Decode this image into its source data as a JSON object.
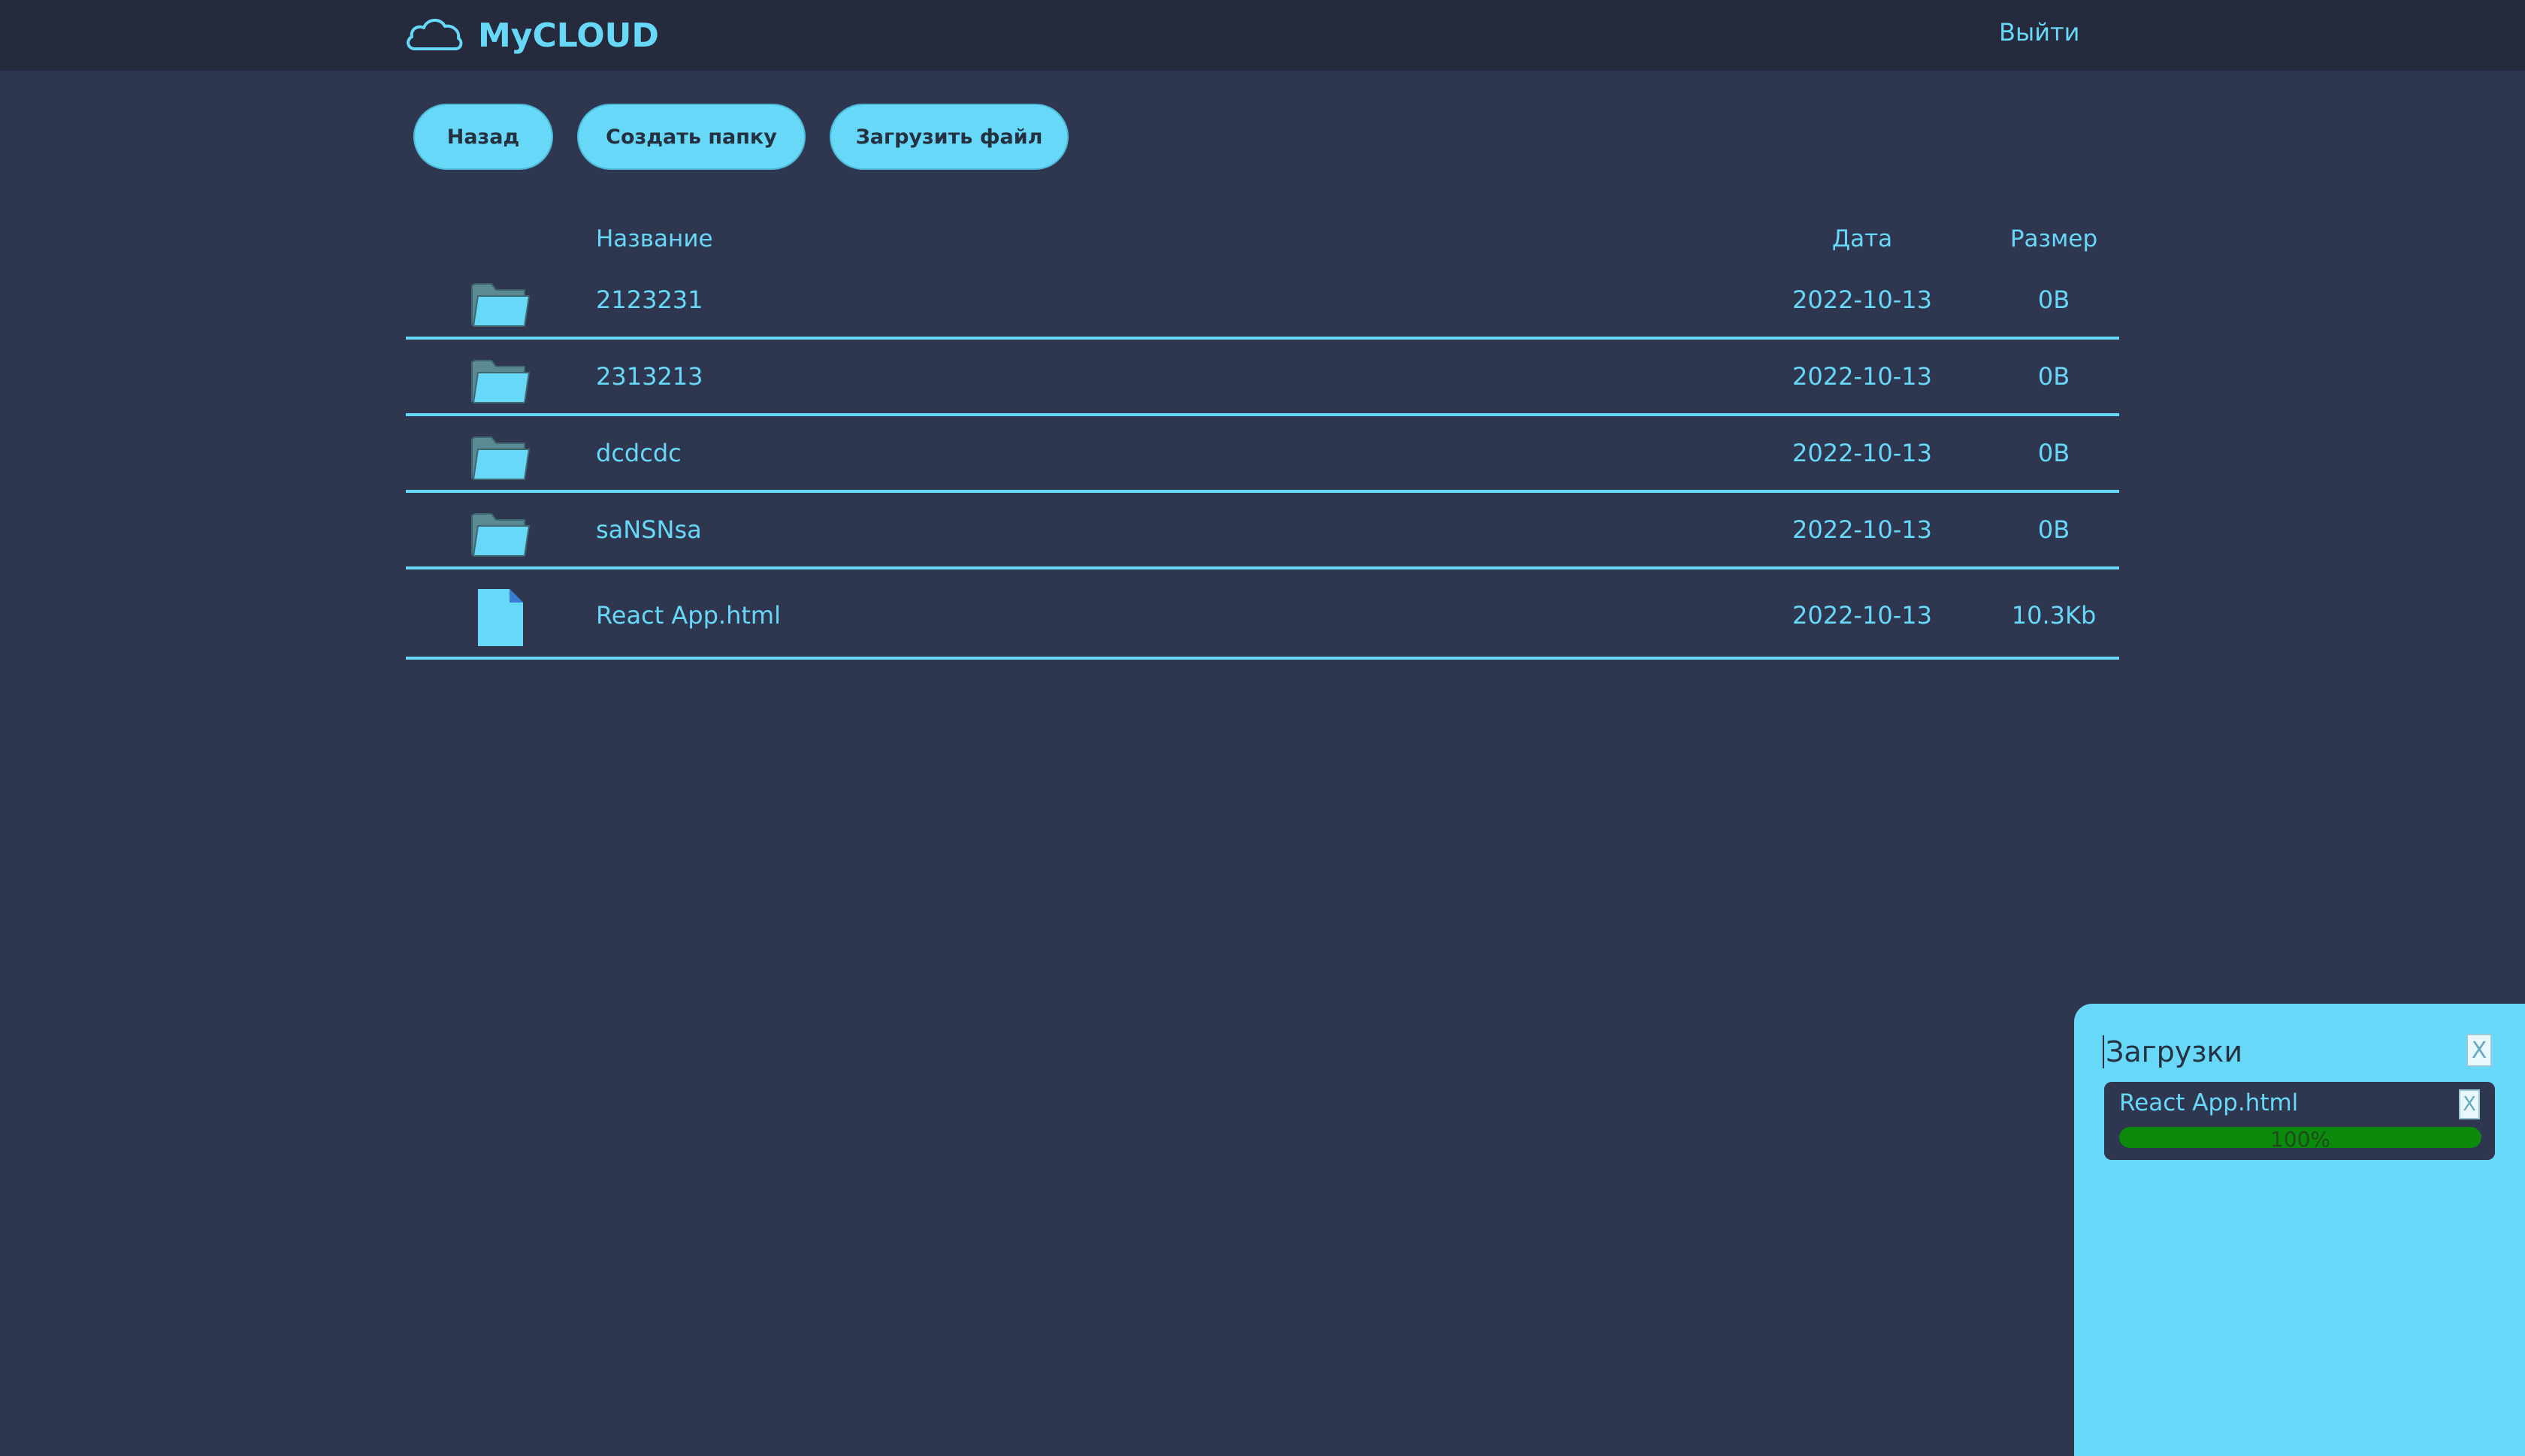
{
  "header": {
    "brand": "MyCLOUD",
    "logout_label": "Выйти",
    "logo_icon": "cloud-icon"
  },
  "toolbar": {
    "back_label": "Назад",
    "create_folder_label": "Создать папку",
    "upload_label": "Загрузить файл"
  },
  "table": {
    "columns": {
      "name": "Название",
      "date": "Дата",
      "size": "Размер"
    },
    "rows": [
      {
        "type": "folder",
        "icon": "folder-icon",
        "name": "2123231",
        "date": "2022-10-13",
        "size": "0B"
      },
      {
        "type": "folder",
        "icon": "folder-icon",
        "name": "2313213",
        "date": "2022-10-13",
        "size": "0B"
      },
      {
        "type": "folder",
        "icon": "folder-icon",
        "name": "dcdcdc",
        "date": "2022-10-13",
        "size": "0B"
      },
      {
        "type": "folder",
        "icon": "folder-icon",
        "name": "saNSNsa",
        "date": "2022-10-13",
        "size": "0B"
      },
      {
        "type": "file",
        "icon": "file-icon",
        "name": "React App.html",
        "date": "2022-10-13",
        "size": "10.3Kb"
      }
    ]
  },
  "uploader": {
    "title": "Загрузки",
    "close_label": "X",
    "items": [
      {
        "name": "React App.html",
        "close_label": "X",
        "progress": 100,
        "progress_label": "100%"
      }
    ]
  },
  "colors": {
    "accent": "#67d8f7",
    "background": "#2e374f",
    "topbar": "#252a3c",
    "progress": "#0c8a0c"
  }
}
